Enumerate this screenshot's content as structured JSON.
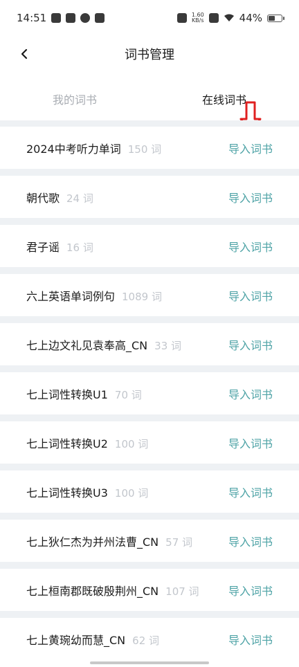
{
  "status_bar": {
    "time": "14:51",
    "speed_top": "1.60",
    "speed_bottom": "KB/s",
    "battery": "44%"
  },
  "header": {
    "title": "词书管理"
  },
  "tabs": [
    {
      "label": "我的词书",
      "active": false
    },
    {
      "label": "在线词书",
      "active": true
    }
  ],
  "books": [
    {
      "name": "2024中考听力单词",
      "count": "150 词",
      "action": "导入词书"
    },
    {
      "name": "朝代歌",
      "count": "24 词",
      "action": "导入词书"
    },
    {
      "name": "君子谣",
      "count": "16 词",
      "action": "导入词书"
    },
    {
      "name": "六上英语单词例句",
      "count": "1089 词",
      "action": "导入词书"
    },
    {
      "name": "七上边文礼见袁奉高_CN",
      "count": "33 词",
      "action": "导入词书"
    },
    {
      "name": "七上词性转换U1",
      "count": "70 词",
      "action": "导入词书"
    },
    {
      "name": "七上词性转换U2",
      "count": "100 词",
      "action": "导入词书"
    },
    {
      "name": "七上词性转换U3",
      "count": "100 词",
      "action": "导入词书"
    },
    {
      "name": "七上狄仁杰为并州法曹_CN",
      "count": "57 词",
      "action": "导入词书"
    },
    {
      "name": "七上桓南郡既破殷荆州_CN",
      "count": "107 词",
      "action": "导入词书"
    },
    {
      "name": "七上黄琬幼而慧_CN",
      "count": "62 词",
      "action": "导入词书"
    }
  ],
  "colors": {
    "accent": "#4ea3a6",
    "annotation_arrow": "#e02020",
    "list_background": "#eef1f4"
  },
  "icons": {
    "back": "chevron-left-icon",
    "annotation": "down-arrow-annotation"
  }
}
